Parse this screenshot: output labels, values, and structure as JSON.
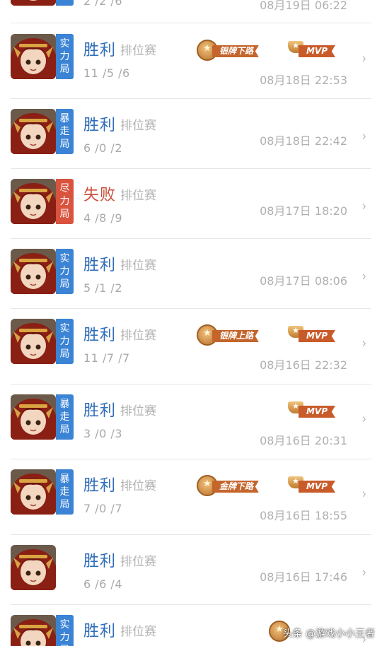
{
  "colors": {
    "win": "#2f6db8",
    "lose": "#c9503b",
    "tag_blue": "#3b83d4",
    "tag_red": "#d9533e"
  },
  "top_partial": {
    "kda": "2 /2 /6",
    "time": "08月19日 06:22"
  },
  "matches": [
    {
      "tag": [
        "实",
        "力",
        "局"
      ],
      "tag_color": "blue",
      "result": "胜利",
      "outcome": "win",
      "mode": "排位赛",
      "kda": "11 /5 /6",
      "time": "08月18日 22:53",
      "badges": [
        {
          "kind": "medal",
          "label": "银牌下路"
        },
        {
          "kind": "mvp",
          "label": "MVP"
        }
      ]
    },
    {
      "tag": [
        "暴",
        "走",
        "局"
      ],
      "tag_color": "blue",
      "result": "胜利",
      "outcome": "win",
      "mode": "排位赛",
      "kda": "6 /0 /2",
      "time": "08月18日 22:42",
      "badges": []
    },
    {
      "tag": [
        "尽",
        "力",
        "局"
      ],
      "tag_color": "red",
      "result": "失败",
      "outcome": "lose",
      "mode": "排位赛",
      "kda": "4 /8 /9",
      "time": "08月17日 18:20",
      "badges": []
    },
    {
      "tag": [
        "实",
        "力",
        "局"
      ],
      "tag_color": "blue",
      "result": "胜利",
      "outcome": "win",
      "mode": "排位赛",
      "kda": "5 /1 /2",
      "time": "08月17日 08:06",
      "badges": []
    },
    {
      "tag": [
        "实",
        "力",
        "局"
      ],
      "tag_color": "blue",
      "result": "胜利",
      "outcome": "win",
      "mode": "排位赛",
      "kda": "11 /7 /7",
      "time": "08月16日 22:32",
      "badges": [
        {
          "kind": "medal",
          "label": "银牌上路"
        },
        {
          "kind": "mvp",
          "label": "MVP"
        }
      ]
    },
    {
      "tag": [
        "暴",
        "走",
        "局"
      ],
      "tag_color": "blue",
      "result": "胜利",
      "outcome": "win",
      "mode": "排位赛",
      "kda": "3 /0 /3",
      "time": "08月16日 20:31",
      "badges": [
        {
          "kind": "mvp",
          "label": "MVP"
        }
      ]
    },
    {
      "tag": [
        "暴",
        "走",
        "局"
      ],
      "tag_color": "blue",
      "result": "胜利",
      "outcome": "win",
      "mode": "排位赛",
      "kda": "7 /0 /7",
      "time": "08月16日 18:55",
      "badges": [
        {
          "kind": "medal",
          "label": "金牌下路"
        },
        {
          "kind": "mvp",
          "label": "MVP"
        }
      ]
    },
    {
      "tag": [],
      "tag_color": "",
      "result": "胜利",
      "outcome": "win",
      "mode": "排位赛",
      "kda": "6 /6 /4",
      "time": "08月16日 17:46",
      "badges": []
    },
    {
      "tag": [
        "实",
        "力",
        "局"
      ],
      "tag_color": "blue",
      "result": "胜利",
      "outcome": "win",
      "mode": "排位赛",
      "kda": "",
      "time": "",
      "badges": [
        {
          "kind": "medal",
          "label": ""
        }
      ]
    }
  ],
  "chevron": "›",
  "watermark": "头条 @游戏小小王者"
}
